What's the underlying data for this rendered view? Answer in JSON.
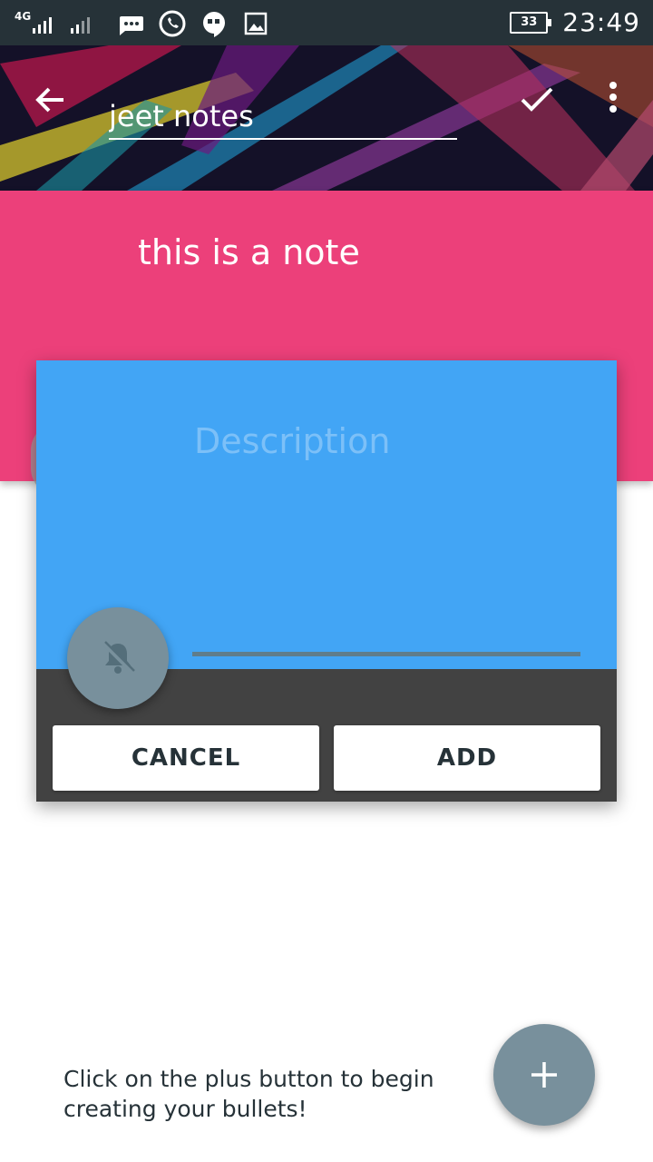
{
  "status_bar": {
    "network_label": "4G",
    "battery_level": "33",
    "time": "23:49",
    "icons": [
      "signal-sim1-icon",
      "signal-sim2-icon",
      "message-icon",
      "whatsapp-icon",
      "hangouts-icon",
      "gallery-icon",
      "battery-icon"
    ]
  },
  "header": {
    "title_value": "jeet notes",
    "icons": [
      "back-arrow-icon",
      "check-icon",
      "more-vert-icon"
    ]
  },
  "note": {
    "text": "this is a note",
    "background_color": "#ec407a"
  },
  "dialog": {
    "description_placeholder": "Description",
    "cancel_label": "CANCEL",
    "add_label": "ADD",
    "accent_color": "#42a5f5",
    "reminder_icon": "bell-off-icon"
  },
  "footer": {
    "hint_text": "Click on the plus button to begin creating your bullets!",
    "fab_icon": "plus-icon"
  }
}
